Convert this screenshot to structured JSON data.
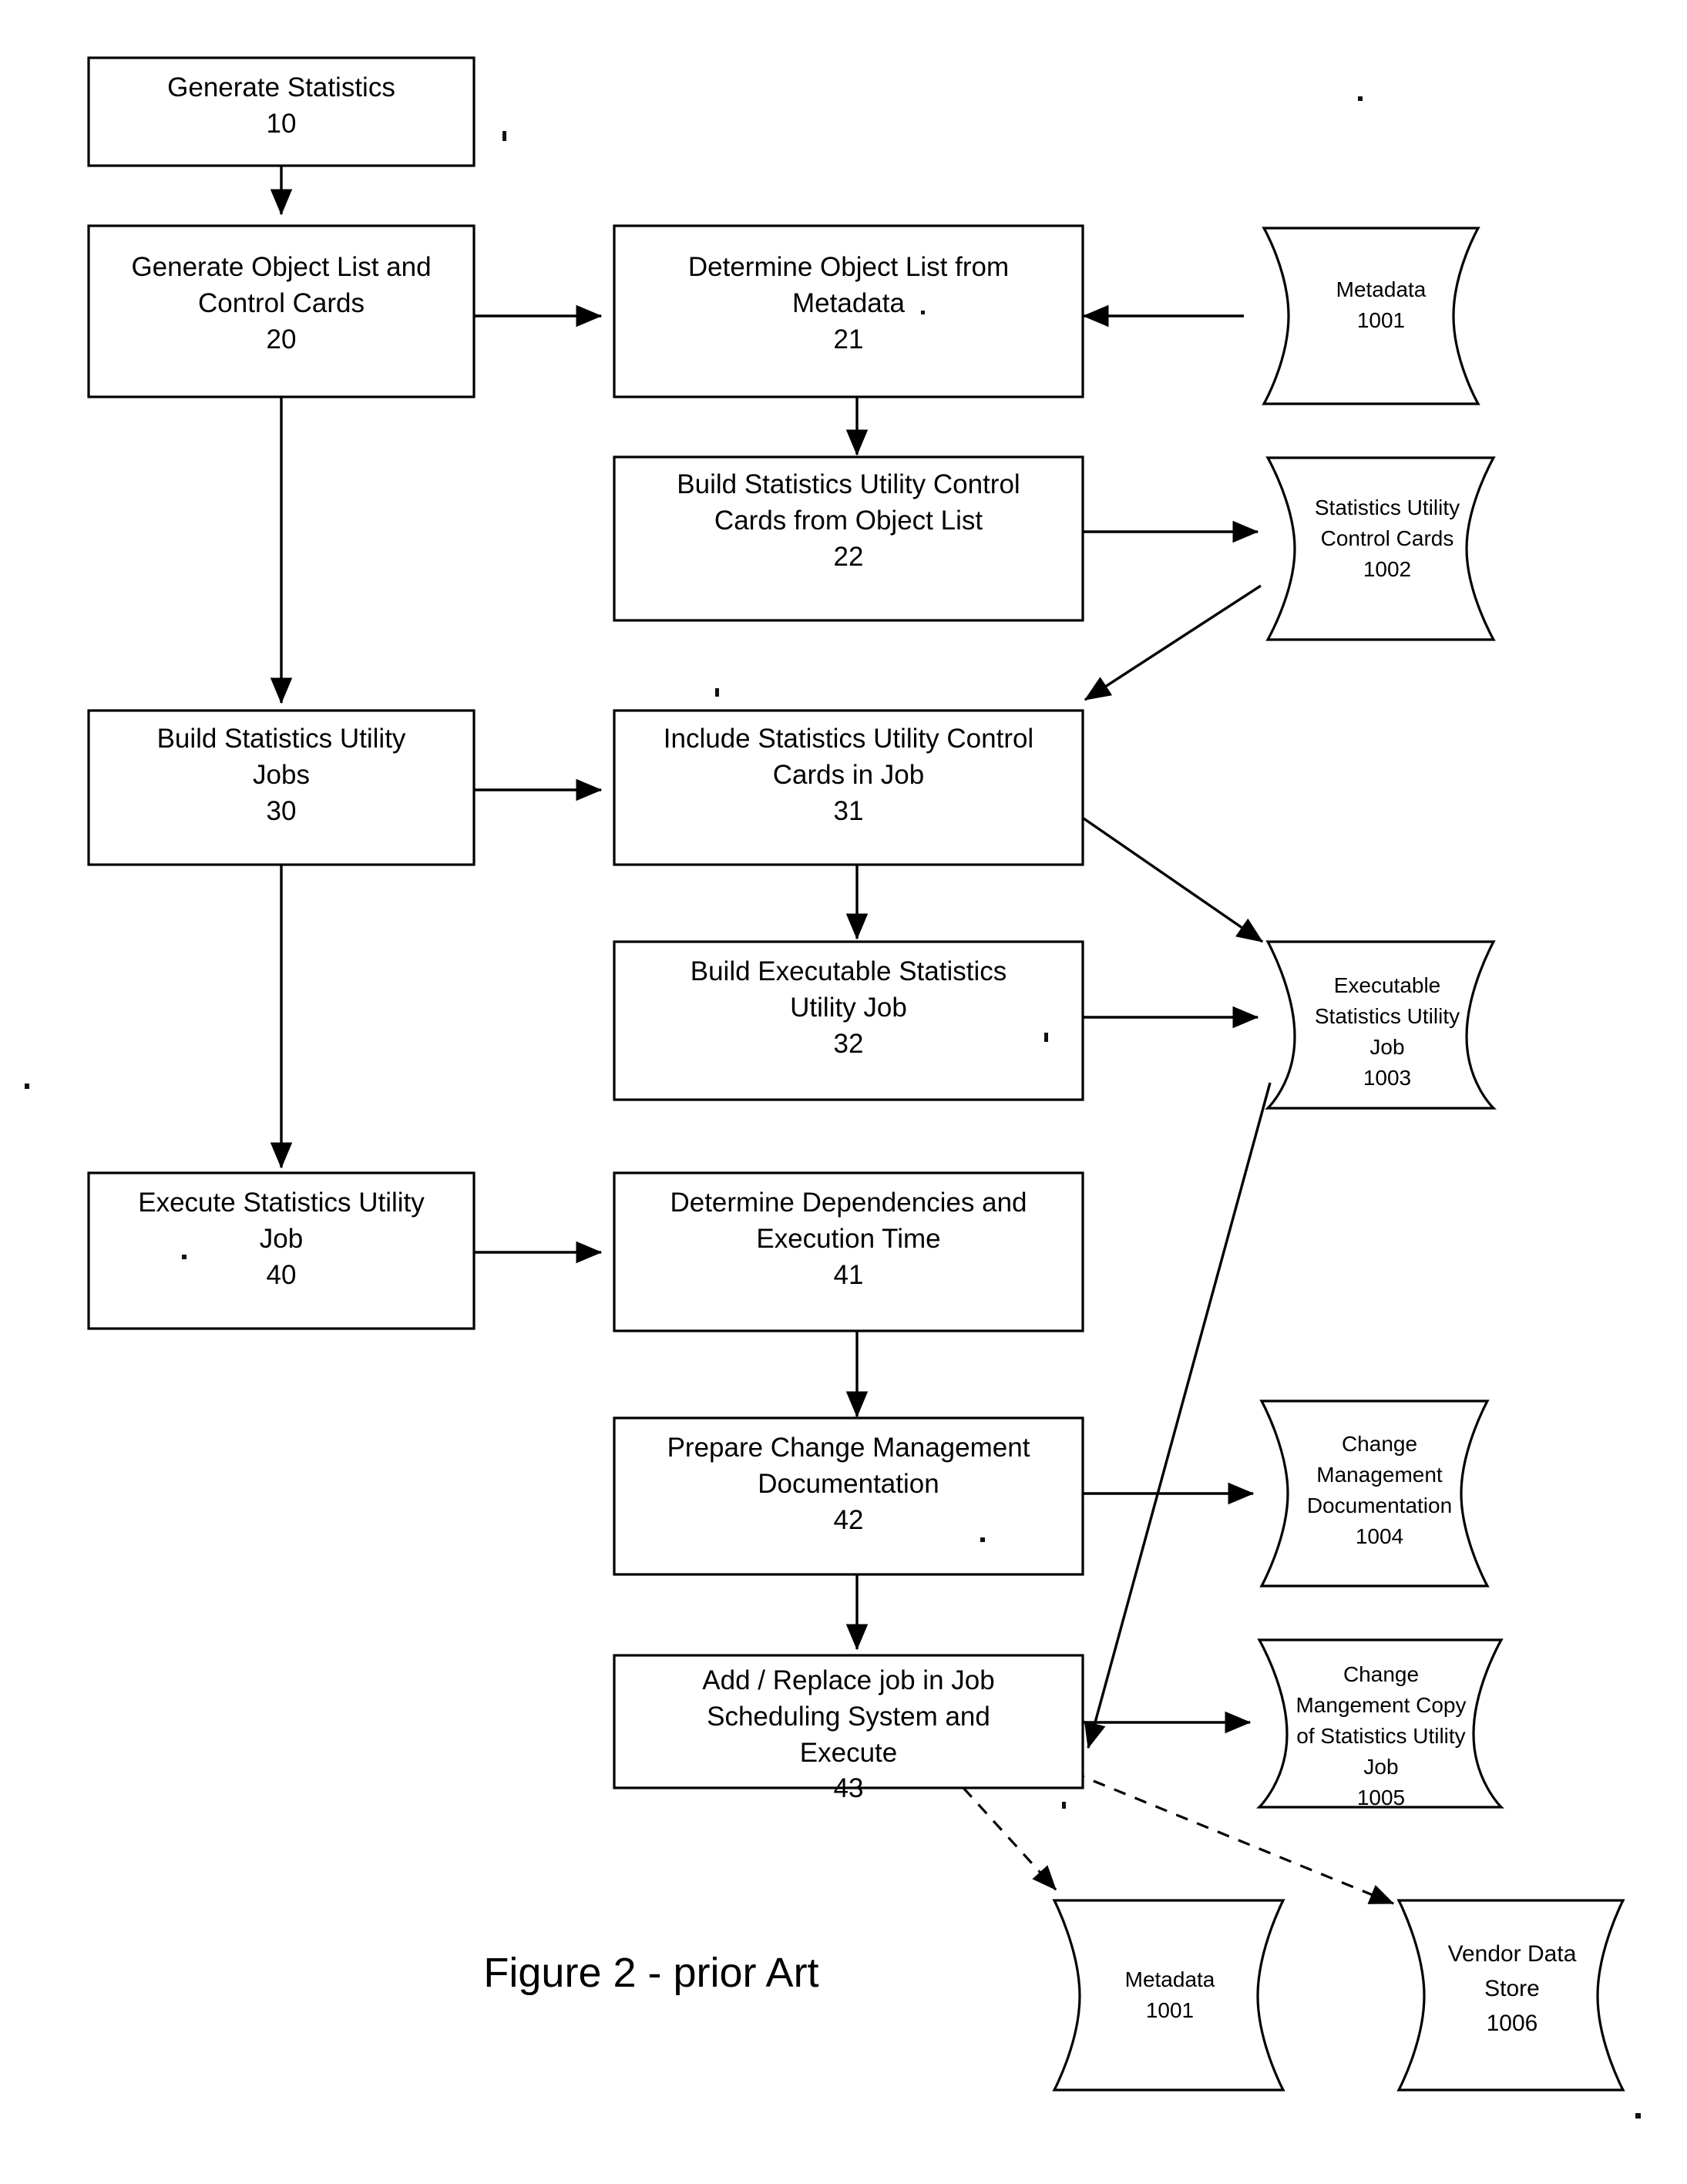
{
  "figure": {
    "caption": "Figure 2 - prior Art"
  },
  "process_boxes": [
    {
      "id": "10",
      "lines": [
        "Generate Statistics"
      ],
      "ref": "10"
    },
    {
      "id": "20",
      "lines": [
        "Generate Object List and",
        "Control Cards"
      ],
      "ref": "20"
    },
    {
      "id": "21",
      "lines": [
        "Determine Object List from",
        "Metadata"
      ],
      "ref": "21"
    },
    {
      "id": "22",
      "lines": [
        "Build Statistics Utility Control",
        "Cards from Object List"
      ],
      "ref": "22"
    },
    {
      "id": "30",
      "lines": [
        "Build Statistics Utility",
        "Jobs"
      ],
      "ref": "30"
    },
    {
      "id": "31",
      "lines": [
        "Include Statistics Utility Control",
        "Cards in Job"
      ],
      "ref": "31"
    },
    {
      "id": "32",
      "lines": [
        "Build Executable Statistics",
        "Utility Job"
      ],
      "ref": "32"
    },
    {
      "id": "40",
      "lines": [
        "Execute Statistics Utility",
        "Job"
      ],
      "ref": "40"
    },
    {
      "id": "41",
      "lines": [
        "Determine Dependencies and",
        "Execution Time"
      ],
      "ref": "41"
    },
    {
      "id": "42",
      "lines": [
        "Prepare Change Management",
        "Documentation"
      ],
      "ref": "42"
    },
    {
      "id": "43",
      "lines": [
        "Add / Replace job in Job",
        "Scheduling System and",
        "Execute"
      ],
      "ref": "43"
    }
  ],
  "data_stores": [
    {
      "id": "1001a",
      "lines": [
        "Metadata"
      ],
      "ref": "1001"
    },
    {
      "id": "1002",
      "lines": [
        "Statistics Utility",
        "Control Cards"
      ],
      "ref": "1002"
    },
    {
      "id": "1003",
      "lines": [
        "Executable",
        "Statistics Utility",
        "Job"
      ],
      "ref": "1003"
    },
    {
      "id": "1004",
      "lines": [
        "Change",
        "Management",
        "Documentation"
      ],
      "ref": "1004"
    },
    {
      "id": "1005",
      "lines": [
        "Change",
        "Mangement Copy",
        "of Statistics Utility",
        "Job"
      ],
      "ref": "1005"
    },
    {
      "id": "1001b",
      "lines": [
        "Metadata"
      ],
      "ref": "1001"
    },
    {
      "id": "1006",
      "lines": [
        "Vendor Data",
        "Store"
      ],
      "ref": "1006"
    }
  ],
  "chart_data": {
    "type": "diagram",
    "title": "Figure 2 - prior Art",
    "diagram_kind": "flowchart",
    "nodes": [
      {
        "ref": "10",
        "label": "Generate Statistics",
        "shape": "process"
      },
      {
        "ref": "20",
        "label": "Generate Object List and Control Cards",
        "shape": "process"
      },
      {
        "ref": "21",
        "label": "Determine Object List from Metadata",
        "shape": "process"
      },
      {
        "ref": "22",
        "label": "Build Statistics Utility Control Cards from Object List",
        "shape": "process"
      },
      {
        "ref": "30",
        "label": "Build Statistics Utility Jobs",
        "shape": "process"
      },
      {
        "ref": "31",
        "label": "Include Statistics Utility Control Cards in Job",
        "shape": "process"
      },
      {
        "ref": "32",
        "label": "Build Executable Statistics Utility Job",
        "shape": "process"
      },
      {
        "ref": "40",
        "label": "Execute Statistics Utility Job",
        "shape": "process"
      },
      {
        "ref": "41",
        "label": "Determine Dependencies and Execution Time",
        "shape": "process"
      },
      {
        "ref": "42",
        "label": "Prepare Change Management Documentation",
        "shape": "process"
      },
      {
        "ref": "43",
        "label": "Add / Replace job in Job Scheduling System and Execute",
        "shape": "process"
      },
      {
        "ref": "1001",
        "label": "Metadata",
        "shape": "data-store"
      },
      {
        "ref": "1002",
        "label": "Statistics Utility Control Cards",
        "shape": "data-store"
      },
      {
        "ref": "1003",
        "label": "Executable Statistics Utility Job",
        "shape": "data-store"
      },
      {
        "ref": "1004",
        "label": "Change Management Documentation",
        "shape": "data-store"
      },
      {
        "ref": "1005",
        "label": "Change Mangement Copy of Statistics Utility Job",
        "shape": "data-store"
      },
      {
        "ref": "1006",
        "label": "Vendor Data Store",
        "shape": "data-store"
      }
    ],
    "edges": [
      {
        "from": "10",
        "to": "20",
        "style": "solid"
      },
      {
        "from": "20",
        "to": "21",
        "style": "solid"
      },
      {
        "from": "20",
        "to": "30",
        "style": "solid"
      },
      {
        "from": "1001",
        "to": "21",
        "style": "solid"
      },
      {
        "from": "21",
        "to": "22",
        "style": "solid"
      },
      {
        "from": "22",
        "to": "1002",
        "style": "solid"
      },
      {
        "from": "1002",
        "to": "31",
        "style": "solid"
      },
      {
        "from": "30",
        "to": "31",
        "style": "solid"
      },
      {
        "from": "30",
        "to": "40",
        "style": "solid"
      },
      {
        "from": "31",
        "to": "32",
        "style": "solid"
      },
      {
        "from": "31",
        "to": "1003",
        "style": "solid"
      },
      {
        "from": "32",
        "to": "1003",
        "style": "solid"
      },
      {
        "from": "40",
        "to": "41",
        "style": "solid"
      },
      {
        "from": "41",
        "to": "42",
        "style": "solid"
      },
      {
        "from": "42",
        "to": "1004",
        "style": "solid"
      },
      {
        "from": "42",
        "to": "43",
        "style": "solid"
      },
      {
        "from": "43",
        "to": "1005",
        "style": "solid"
      },
      {
        "from": "1003",
        "to": "43",
        "style": "solid"
      },
      {
        "from": "43",
        "to": "1001",
        "style": "dashed"
      },
      {
        "from": "43",
        "to": "1006",
        "style": "dashed"
      }
    ]
  }
}
